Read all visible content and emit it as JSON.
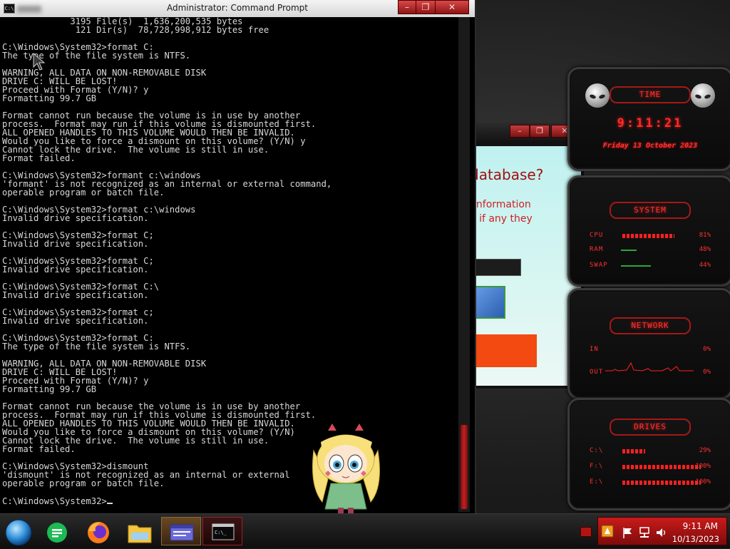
{
  "window": {
    "title": "Administrator: Command Prompt",
    "controls": [
      "–",
      "❐",
      "✕"
    ]
  },
  "console": {
    "lines": [
      "             3195 File(s)  1,636,200,535 bytes",
      "              121 Dir(s)  78,728,998,912 bytes free",
      "",
      "C:\\Windows\\System32>format C:",
      "The type of the file system is NTFS.",
      "",
      "WARNING, ALL DATA ON NON-REMOVABLE DISK",
      "DRIVE C: WILL BE LOST!",
      "Proceed with Format (Y/N)? y",
      "Formatting 99.7 GB",
      "",
      "Format cannot run because the volume is in use by another",
      "process.  Format may run if this volume is dismounted first.",
      "ALL OPENED HANDLES TO THIS VOLUME WOULD THEN BE INVALID.",
      "Would you like to force a dismount on this volume? (Y/N) y",
      "Cannot lock the drive.  The volume is still in use.",
      "Format failed.",
      "",
      "C:\\Windows\\System32>formant c:\\windows",
      "'formant' is not recognized as an internal or external command,",
      "operable program or batch file.",
      "",
      "C:\\Windows\\System32>format c:\\windows",
      "Invalid drive specification.",
      "",
      "C:\\Windows\\System32>format C;",
      "Invalid drive specification.",
      "",
      "C:\\Windows\\System32>format C;",
      "Invalid drive specification.",
      "",
      "C:\\Windows\\System32>format C:\\",
      "Invalid drive specification.",
      "",
      "C:\\Windows\\System32>format c;",
      "Invalid drive specification.",
      "",
      "C:\\Windows\\System32>format C:",
      "The type of the file system is NTFS.",
      "",
      "WARNING, ALL DATA ON NON-REMOVABLE DISK",
      "DRIVE C: WILL BE LOST!",
      "Proceed with Format (Y/N)? y",
      "Formatting 99.7 GB",
      "",
      "Format cannot run because the volume is in use by another",
      "process.  Format may run if this volume is dismounted first.",
      "ALL OPENED HANDLES TO THIS VOLUME WOULD THEN BE INVALID.",
      "Would you like to force a dismount on this volume? (Y/N)",
      "Cannot lock the drive.  The volume is still in use.",
      "Format failed.",
      "",
      "C:\\Windows\\System32>dismount",
      "'dismount' is not recognized as an internal or external",
      "operable program or batch file.",
      ""
    ],
    "prompt": "C:\\Windows\\System32>"
  },
  "background_dialog": {
    "controls": [
      "–",
      "❐",
      "✕"
    ],
    "question": "database?",
    "line1": "information",
    "line2": "e if any they"
  },
  "gadgets": {
    "time": {
      "header": "TIME",
      "clock": "9:11:21",
      "date": "Friday 13 October 2023"
    },
    "system": {
      "header": "SYSTEM",
      "rows": [
        {
          "label": "CPU",
          "value": "81%",
          "level": 0.81
        },
        {
          "label": "RAM",
          "value": "48%",
          "level": 0.48
        },
        {
          "label": "SWAP",
          "value": "44%",
          "level": 0.44
        }
      ]
    },
    "network": {
      "header": "NETWORK",
      "rows": [
        {
          "label": "IN",
          "value": "0%"
        },
        {
          "label": "OUT",
          "value": "0%"
        }
      ]
    },
    "drives": {
      "header": "DRIVES",
      "rows": [
        {
          "label": "C:\\",
          "value": "29%",
          "level": 0.29
        },
        {
          "label": "F:\\",
          "value": "100%",
          "level": 1.0
        },
        {
          "label": "E:\\",
          "value": "100%",
          "level": 1.0
        }
      ]
    }
  },
  "taskbar": {
    "apps": [
      "start-orb",
      "notes",
      "firefox",
      "file-explorer",
      "control-panel",
      "command-prompt"
    ],
    "tray_time": "9:11 AM",
    "tray_date": "10/13/2023"
  },
  "colors": {
    "accent_red": "#ff2a2a",
    "console_text": "#d8d8d8",
    "dialog_orange": "#f24a10"
  }
}
